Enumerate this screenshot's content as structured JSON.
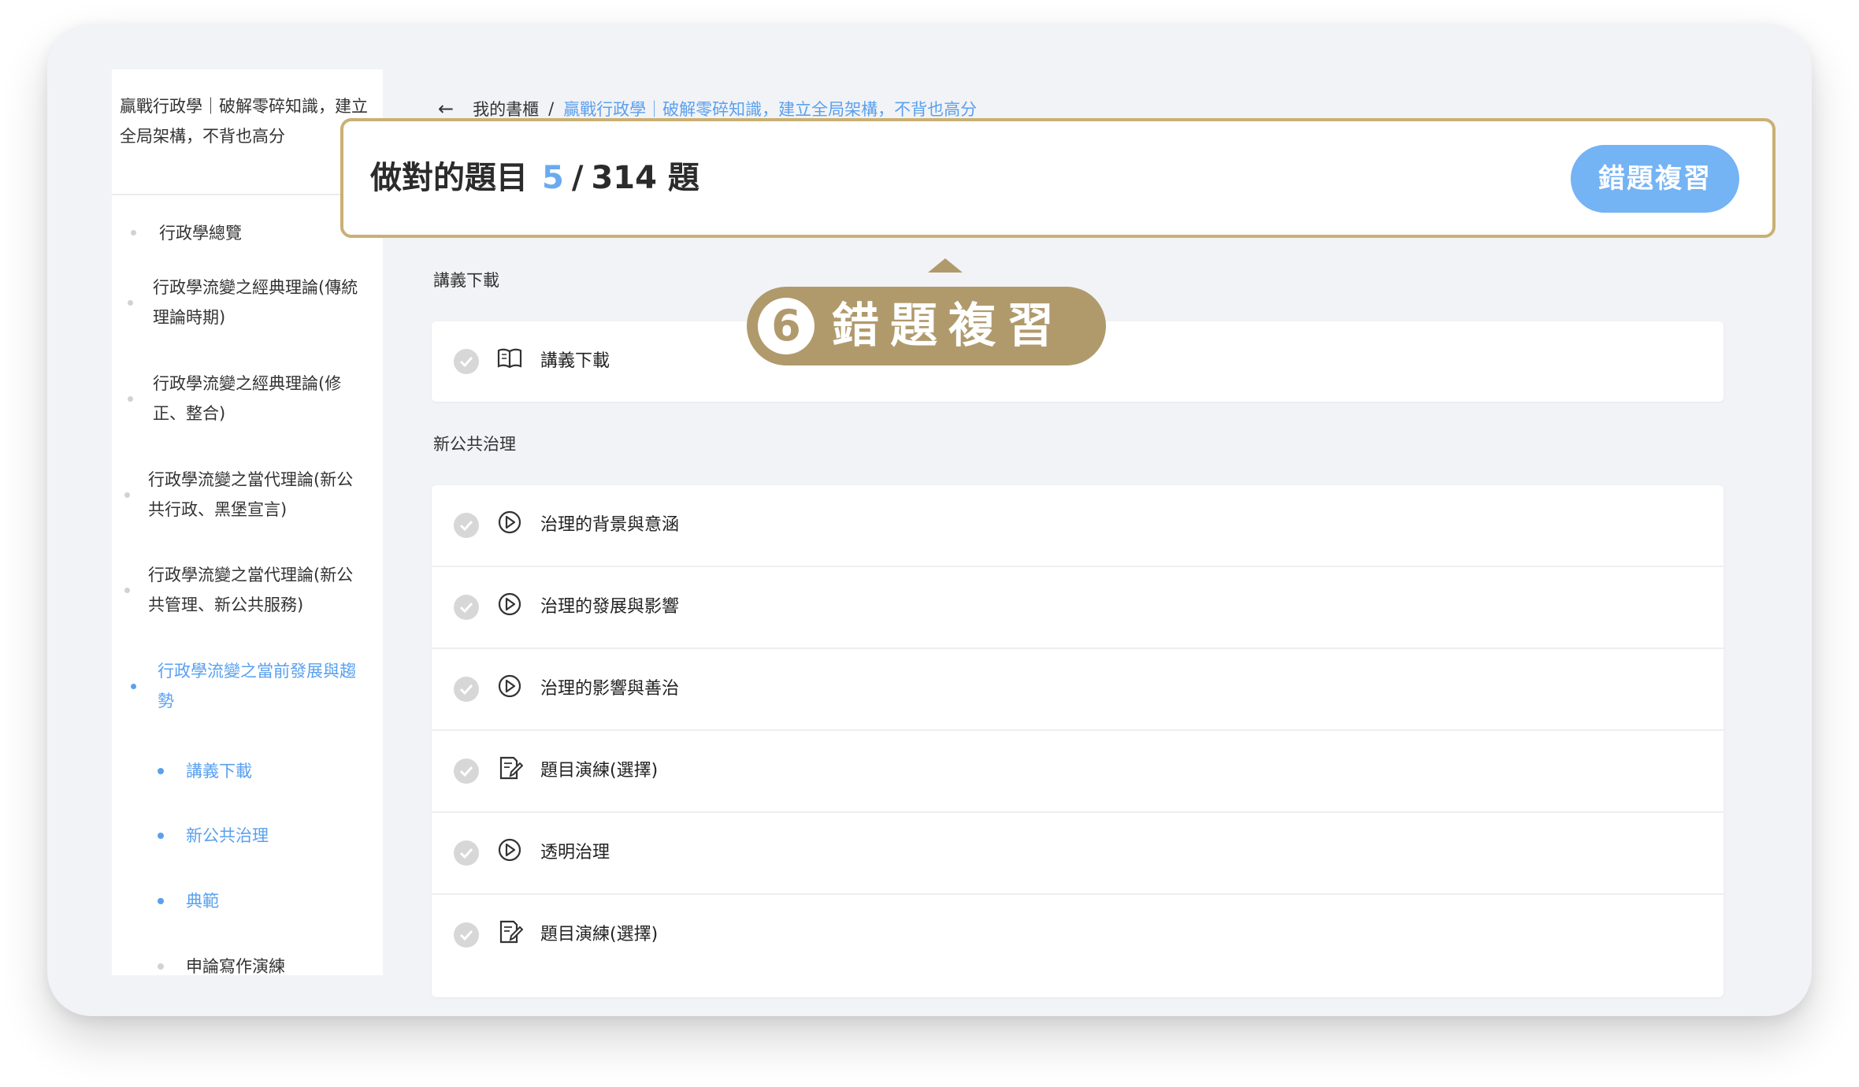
{
  "sidebar": {
    "title": "贏戰行政學｜破解零碎知識，建立全局架構，不背也高分",
    "items": [
      {
        "label": "行政學總覽"
      },
      {
        "label": "行政學流變之經典理論(傳統理論時期)"
      },
      {
        "label": "行政學流變之經典理論(修正、整合)"
      },
      {
        "label": "行政學流變之當代理論(新公共行政、黑堡宣言)"
      },
      {
        "label": "行政學流變之當代理論(新公共管理、新公共服務)"
      },
      {
        "label": "行政學流變之當前發展與趨勢"
      }
    ],
    "subitems": [
      {
        "label": "講義下載"
      },
      {
        "label": "新公共治理"
      },
      {
        "label": "典範"
      },
      {
        "label": "申論寫作演練"
      }
    ]
  },
  "breadcrumb": {
    "back_icon": "arrow-left-icon",
    "home": "我的書櫃",
    "separator": "/",
    "current": "贏戰行政學｜破解零碎知識，建立全局架構，不背也高分"
  },
  "score": {
    "label": "做對的題目",
    "correct": "5",
    "slash": "/",
    "total": "314 題",
    "review_button": "錯題複習"
  },
  "callout": {
    "number": "6",
    "text": "錯題複習"
  },
  "sections": [
    {
      "title": "講義下載",
      "rows": [
        {
          "icon": "book-icon",
          "label": "講義下載"
        }
      ]
    },
    {
      "title": "新公共治理",
      "rows": [
        {
          "icon": "play-icon",
          "label": "治理的背景與意涵"
        },
        {
          "icon": "play-icon",
          "label": "治理的發展與影響"
        },
        {
          "icon": "play-icon",
          "label": "治理的影響與善治"
        },
        {
          "icon": "exercise-icon",
          "label": "題目演練(選擇)"
        },
        {
          "icon": "play-icon",
          "label": "透明治理"
        },
        {
          "icon": "exercise-icon",
          "label": "題目演練(選擇)"
        }
      ]
    }
  ],
  "colors": {
    "accent_blue": "#5aa0ef",
    "highlight_gold": "#c9b074",
    "callout_gold": "#b09a6c"
  }
}
